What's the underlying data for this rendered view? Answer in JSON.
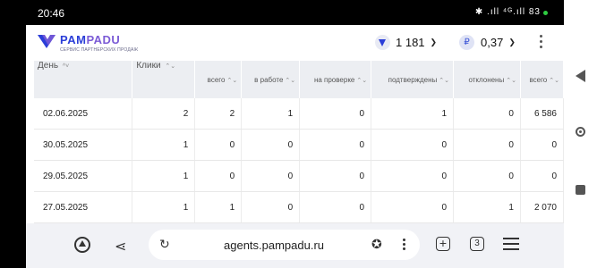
{
  "status": {
    "time": "20:46",
    "icons": "✱ .ıll ⁴ᴳ.ıll 83"
  },
  "header": {
    "logo_pam": "PAM",
    "logo_padu": "PADU",
    "logo_sub": "СЕРВИС ПАРТНЕРСКИХ ПРОДАЖ",
    "balance1": "1 181",
    "balance2": "0,37",
    "ruble_symbol": "₽"
  },
  "table": {
    "columns": [
      "День",
      "Клики",
      "всего",
      "в работе",
      "на проверке",
      "подтверждены",
      "отклонены",
      "всего"
    ],
    "rows": [
      [
        "02.06.2025",
        "2",
        "2",
        "1",
        "0",
        "1",
        "0",
        "6 586"
      ],
      [
        "30.05.2025",
        "1",
        "0",
        "0",
        "0",
        "0",
        "0",
        "0"
      ],
      [
        "29.05.2025",
        "1",
        "0",
        "0",
        "0",
        "0",
        "0",
        "0"
      ],
      [
        "27.05.2025",
        "1",
        "1",
        "0",
        "0",
        "0",
        "1",
        "2 070"
      ]
    ]
  },
  "browser": {
    "url": "agents.pampadu.ru",
    "tab_count": "3"
  },
  "colors": {
    "brand_blue": "#2b3ed8",
    "brand_purple": "#7b5bd6",
    "header_bg": "#eceef2"
  }
}
